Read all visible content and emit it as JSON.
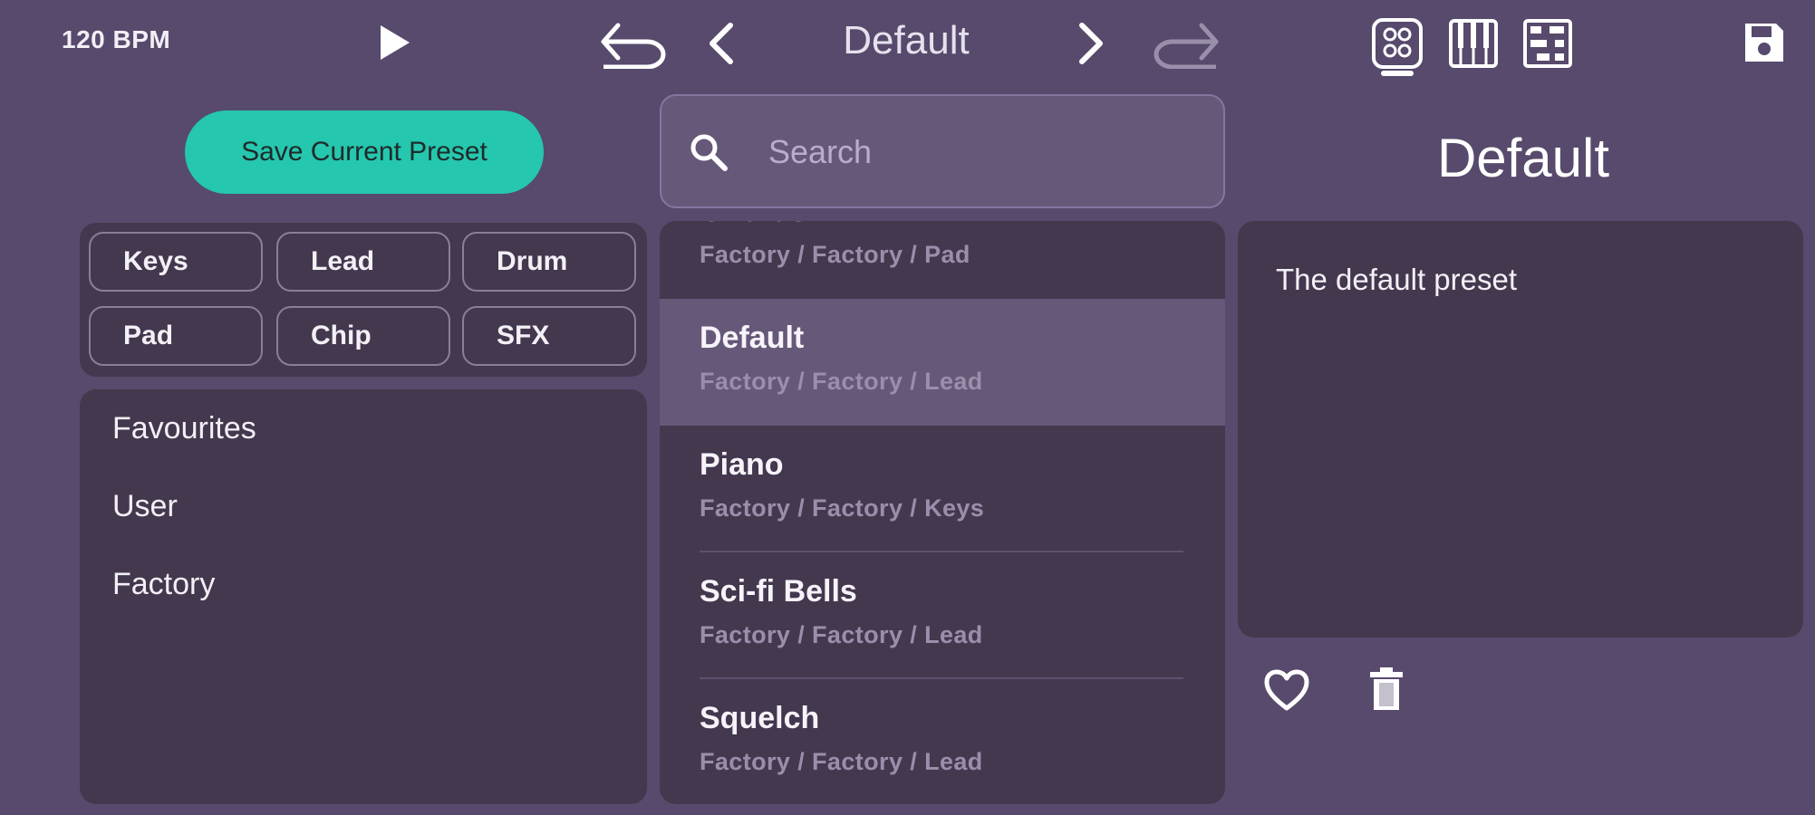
{
  "topbar": {
    "bpm": "120 BPM",
    "current_preset": "Default",
    "icons": [
      "play-icon",
      "undo-icon",
      "chevron-left-icon",
      "chevron-right-icon",
      "redo-icon",
      "octagon-pad-icon",
      "piano-keys-icon",
      "step-grid-icon",
      "save-icon"
    ]
  },
  "left": {
    "save_button": "Save Current Preset",
    "tags": [
      "Keys",
      "Lead",
      "Drum",
      "Pad",
      "Chip",
      "SFX"
    ],
    "folders": [
      "Favourites",
      "User",
      "Factory"
    ]
  },
  "search": {
    "placeholder": "Search",
    "value": ""
  },
  "presets": [
    {
      "name": "Chorus",
      "path": "Factory / Factory / Pad",
      "selected": false
    },
    {
      "name": "Default",
      "path": "Factory / Factory / Lead",
      "selected": true
    },
    {
      "name": "Piano",
      "path": "Factory / Factory / Keys",
      "selected": false
    },
    {
      "name": "Sci-fi Bells",
      "path": "Factory / Factory / Lead",
      "selected": false
    },
    {
      "name": "Squelch",
      "path": "Factory / Factory / Lead",
      "selected": false
    }
  ],
  "detail": {
    "title": "Default",
    "description": "The default preset"
  },
  "colors": {
    "background": "#574a6c",
    "panel": "#44384f",
    "selected_row": "#665879",
    "accent": "#25c7ae"
  }
}
